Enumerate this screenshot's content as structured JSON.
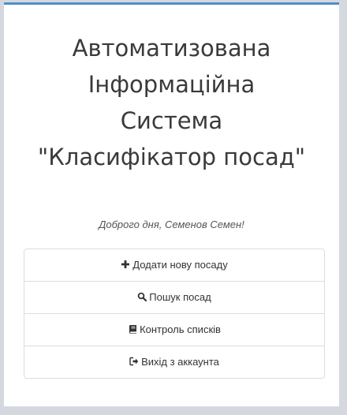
{
  "header": {
    "title_lines": [
      "Автоматизована",
      "Інформаційна",
      "Система",
      "\"Класифікатор посад\""
    ]
  },
  "greeting": "Доброго дня, Семенов Семен!",
  "menu": {
    "items": [
      {
        "label": "Додати нову посаду",
        "icon": "plus-icon"
      },
      {
        "label": "Пошук посад",
        "icon": "search-icon"
      },
      {
        "label": "Контроль списків",
        "icon": "book-icon"
      },
      {
        "label": "Вихід з аккаунта",
        "icon": "logout-icon"
      }
    ]
  },
  "colors": {
    "accent": "#4f8fc9",
    "background": "#d5d9df",
    "panel": "#ffffff",
    "text": "#333333",
    "border": "#dddddd"
  }
}
